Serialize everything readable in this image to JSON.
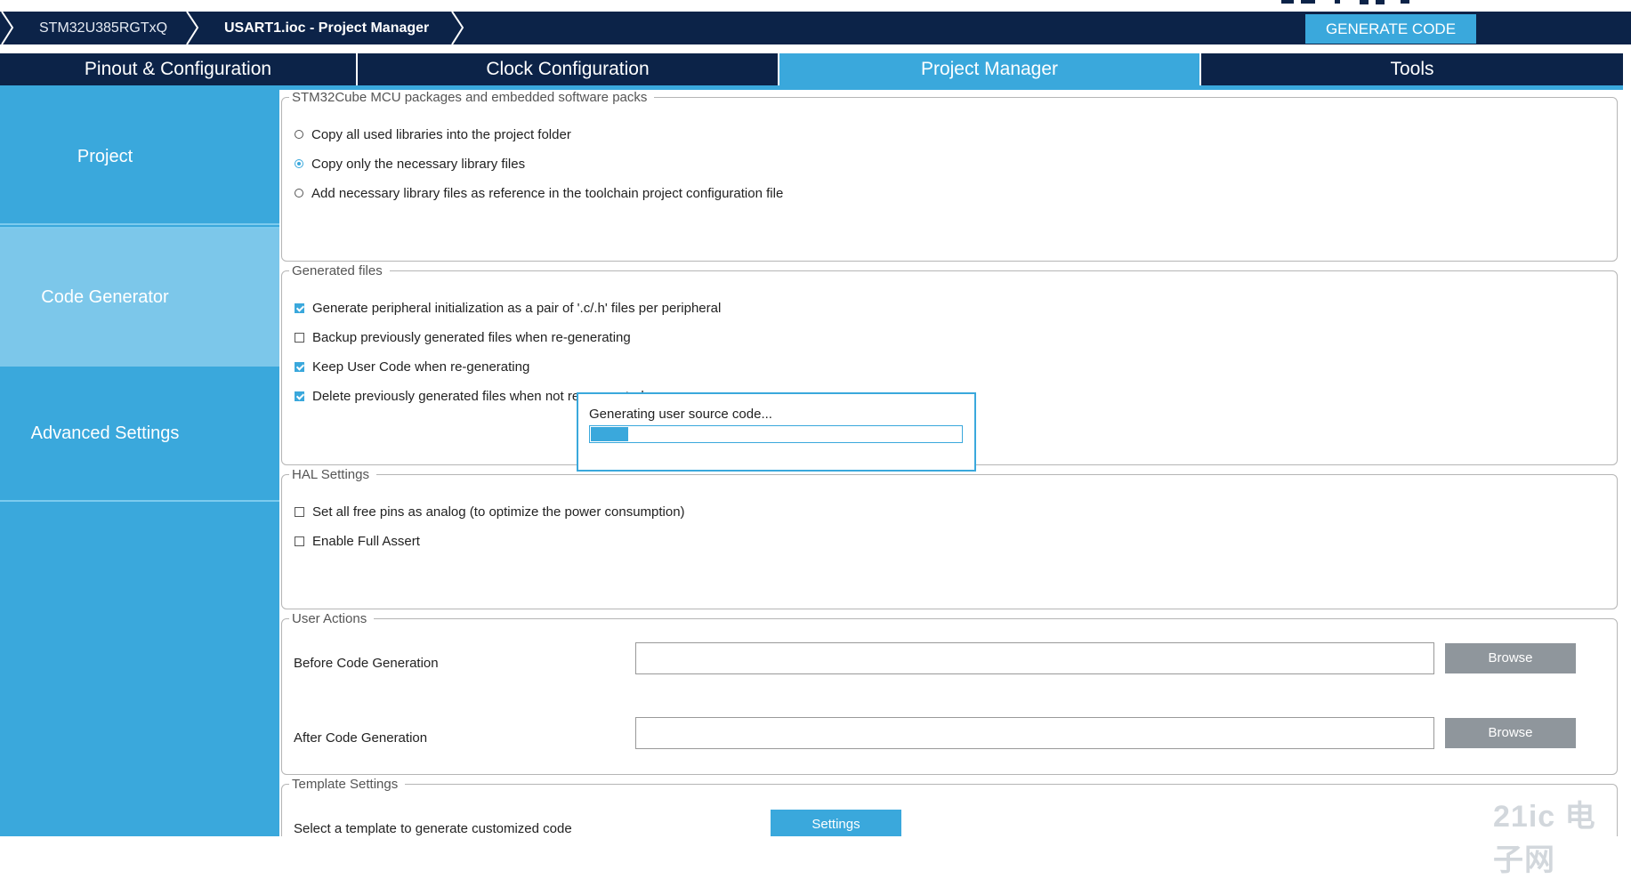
{
  "breadcrumb": {
    "device": "STM32U385RGTxQ",
    "file": "USART1.ioc - Project Manager"
  },
  "generate_button": "GENERATE CODE",
  "tabs": [
    {
      "label": "Pinout & Configuration",
      "active": false
    },
    {
      "label": "Clock Configuration",
      "active": false
    },
    {
      "label": "Project Manager",
      "active": true
    },
    {
      "label": "Tools",
      "active": false
    }
  ],
  "sidebar": {
    "items": [
      {
        "label": "Project",
        "selected": false
      },
      {
        "label": "Code Generator",
        "selected": true
      },
      {
        "label": "Advanced Settings",
        "selected": false
      }
    ]
  },
  "packages_group": {
    "legend": "STM32Cube MCU packages and embedded software packs",
    "options": [
      {
        "label": "Copy all used libraries into the project folder",
        "selected": false
      },
      {
        "label": "Copy only the necessary library files",
        "selected": true
      },
      {
        "label": "Add necessary library files as reference in the toolchain project configuration file",
        "selected": false
      }
    ]
  },
  "generated_files_group": {
    "legend": "Generated files",
    "options": [
      {
        "label": "Generate peripheral initialization as a pair of '.c/.h' files per peripheral",
        "checked": true
      },
      {
        "label": "Backup previously generated files when re-generating",
        "checked": false
      },
      {
        "label": "Keep User Code when re-generating",
        "checked": true
      },
      {
        "label": "Delete previously generated files when not re-generated",
        "checked": true
      }
    ]
  },
  "hal_group": {
    "legend": "HAL Settings",
    "options": [
      {
        "label": "Set all free pins as analog (to optimize the power consumption)",
        "checked": false
      },
      {
        "label": "Enable Full Assert",
        "checked": false
      }
    ]
  },
  "user_actions_group": {
    "legend": "User Actions",
    "before_label": "Before Code Generation",
    "before_value": "",
    "after_label": "After Code Generation",
    "after_value": "",
    "browse_label": "Browse"
  },
  "template_group": {
    "legend": "Template Settings",
    "label": "Select a template to generate customized code",
    "settings_label": "Settings"
  },
  "progress_dialog": {
    "message": "Generating user source code...",
    "progress": 0.1
  },
  "watermark": "21ic 电子网",
  "colors": {
    "navy": "#0c2348",
    "accent": "#3aa8dc",
    "sidebar_selected": "#7cc7ea",
    "browse_gray": "#8f969c"
  }
}
